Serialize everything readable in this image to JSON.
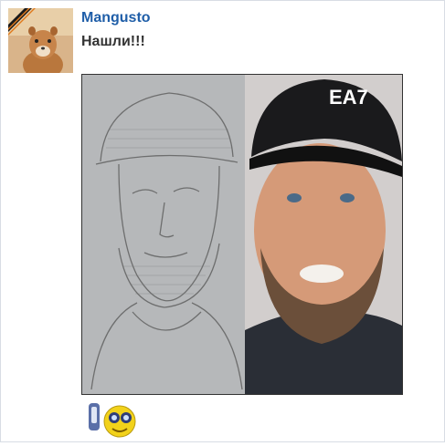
{
  "post": {
    "author": "Mangusto",
    "text": "Нашли!!!"
  },
  "image": {
    "cap_text": "EA7"
  },
  "icons": {
    "avatar": "mongoose-avatar-icon",
    "emoticon": "binoculars-smiley-icon"
  },
  "colors": {
    "username": "#1f5ea8",
    "text": "#333333",
    "border": "#d8dde4"
  }
}
